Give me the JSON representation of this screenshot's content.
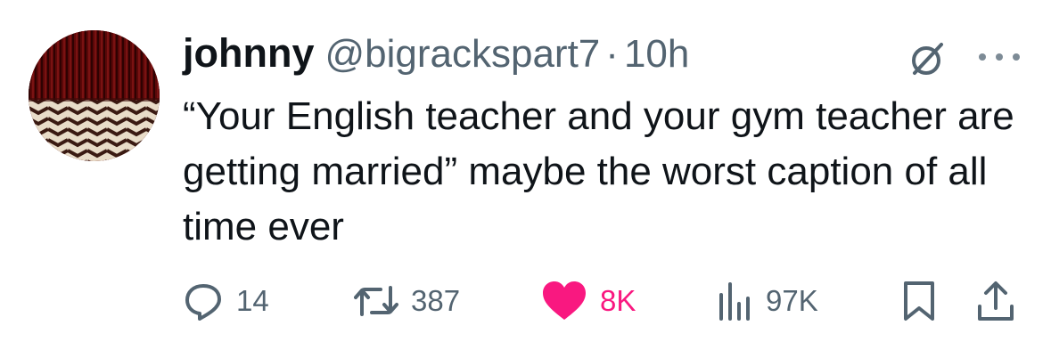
{
  "tweet": {
    "author_name": "johnny",
    "handle": "@bigrackspart7",
    "separator": "·",
    "timestamp": "10h",
    "text": "“Your English teacher and your gym teacher are getting married” maybe the worst caption of all time ever"
  },
  "actions": {
    "replies": "14",
    "retweets": "387",
    "likes": "8K",
    "views": "97K"
  },
  "icons": {
    "reply": "speech-bubble-icon",
    "retweet": "retweet-arrows-icon",
    "like": "heart-filled-icon",
    "views": "bar-chart-icon",
    "bookmark": "bookmark-icon",
    "share": "share-upload-icon",
    "grok": "grok-slash-icon",
    "more": "more-dots-icon"
  },
  "colors": {
    "text": "#0f1419",
    "secondary": "#536471",
    "like": "#f91880"
  }
}
